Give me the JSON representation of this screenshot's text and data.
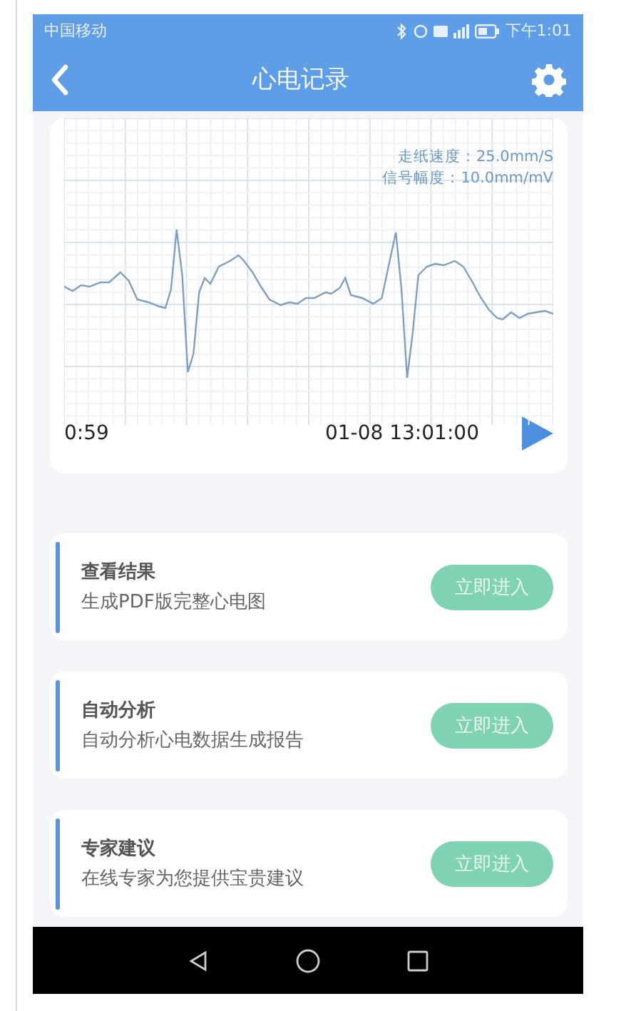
{
  "status_bar": {
    "carrier": "中国移动",
    "time": "下午1:01"
  },
  "nav_bar": {
    "title": "心电记录"
  },
  "ecg": {
    "paper_speed": "走纸速度：25.0mm/S",
    "amplitude": "信号幅度：10.0mm/mV",
    "duration": "0:59",
    "timestamp": "01-08 13:01:00"
  },
  "actions": [
    {
      "title": "查看结果",
      "subtitle": "生成PDF版完整心电图",
      "button": "立即进入"
    },
    {
      "title": "自动分析",
      "subtitle": "自动分析心电数据生成报告",
      "button": "立即进入"
    },
    {
      "title": "专家建议",
      "subtitle": "在线专家为您提供宝贵建议",
      "button": "立即进入"
    }
  ]
}
